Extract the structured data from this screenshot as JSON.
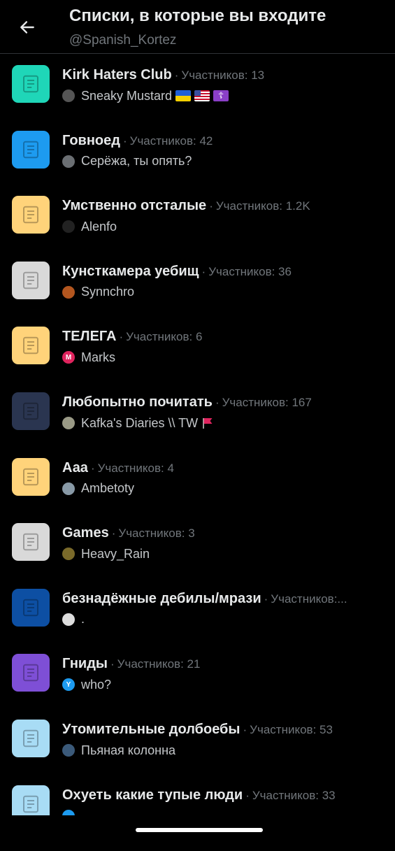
{
  "header": {
    "title": "Списки, в которые вы входите",
    "handle": "@Spanish_Kortez"
  },
  "separator": "·",
  "lists": [
    {
      "name": "Kirk Haters Club",
      "members": "Участников: 13",
      "owner": "Sneaky Mustard",
      "owner_flags": [
        "ua-flag",
        "us-flag",
        "orthodox-cross"
      ],
      "thumb_color": "#1fd6b8",
      "avatar_icon": "person-avatar",
      "avatar_color": "#555"
    },
    {
      "name": "Говноед",
      "members": "Участников: 42",
      "owner": "Серёжа, ты опять?",
      "owner_flags": [],
      "thumb_color": "#1d9bf0",
      "avatar_icon": "photo-avatar",
      "avatar_color": "#6b6f73"
    },
    {
      "name": "Умственно отсталые",
      "members": "Участников: 1.2K",
      "owner": "Alenfo",
      "owner_flags": [],
      "thumb_color": "#ffd37a",
      "avatar_icon": "figure-avatar",
      "avatar_color": "#222"
    },
    {
      "name": "Кунсткамера уебищ",
      "members": "Участников: 36",
      "owner": "Synnchro",
      "owner_flags": [],
      "thumb_color": "#d9d9d9",
      "avatar_icon": "art-avatar",
      "avatar_color": "#b3561f"
    },
    {
      "name": "ТЕЛЕГА",
      "members": "Участников: 6",
      "owner": "Marks",
      "owner_flags": [],
      "thumb_color": "#ffd37a",
      "avatar_icon": "letter-m-avatar",
      "avatar_letter": "M",
      "avatar_color": "#e0245e"
    },
    {
      "name": "Любопытно почитать",
      "members": "Участников: 167",
      "owner": "Kafka's Diaries \\\\ TW",
      "owner_flags": [
        "red-flag"
      ],
      "thumb_color": "#2a3550",
      "avatar_icon": "coin-avatar",
      "avatar_color": "#9a9a86"
    },
    {
      "name": "Ааа",
      "members": "Участников: 4",
      "owner": "Ambetoty",
      "owner_flags": [],
      "thumb_color": "#ffd37a",
      "avatar_icon": "default-avatar",
      "avatar_color": "#8899a6"
    },
    {
      "name": "Games",
      "members": "Участников: 3",
      "owner": "Heavy_Rain",
      "owner_flags": [],
      "thumb_color": "#d9d9d9",
      "avatar_icon": "game-avatar",
      "avatar_color": "#7a6a2a"
    },
    {
      "name": "безнадёжные дебилы/мрази",
      "members": "Участников:...",
      "owner": ".",
      "owner_flags": [],
      "thumb_color": "#0d4fa3",
      "avatar_icon": "skull-avatar",
      "avatar_color": "#ddd"
    },
    {
      "name": "Гниды",
      "members": "Участников: 21",
      "owner": "who?",
      "owner_flags": [],
      "thumb_color": "#7e4fd6",
      "avatar_icon": "letter-y-avatar",
      "avatar_letter": "Y",
      "avatar_color": "#1d9bf0"
    },
    {
      "name": "Утомительные долбоебы",
      "members": "Участников: 53",
      "owner": "Пьяная колонна",
      "owner_flags": [],
      "thumb_color": "#a8dcf5",
      "avatar_icon": "crowd-avatar",
      "avatar_color": "#3b5a7a"
    },
    {
      "name": "Охуеть какие тупые люди",
      "members": "Участников: 33",
      "owner": "",
      "owner_flags": [],
      "thumb_color": "#a8dcf5",
      "avatar_icon": "default-avatar",
      "avatar_color": "#1d9bf0"
    }
  ]
}
